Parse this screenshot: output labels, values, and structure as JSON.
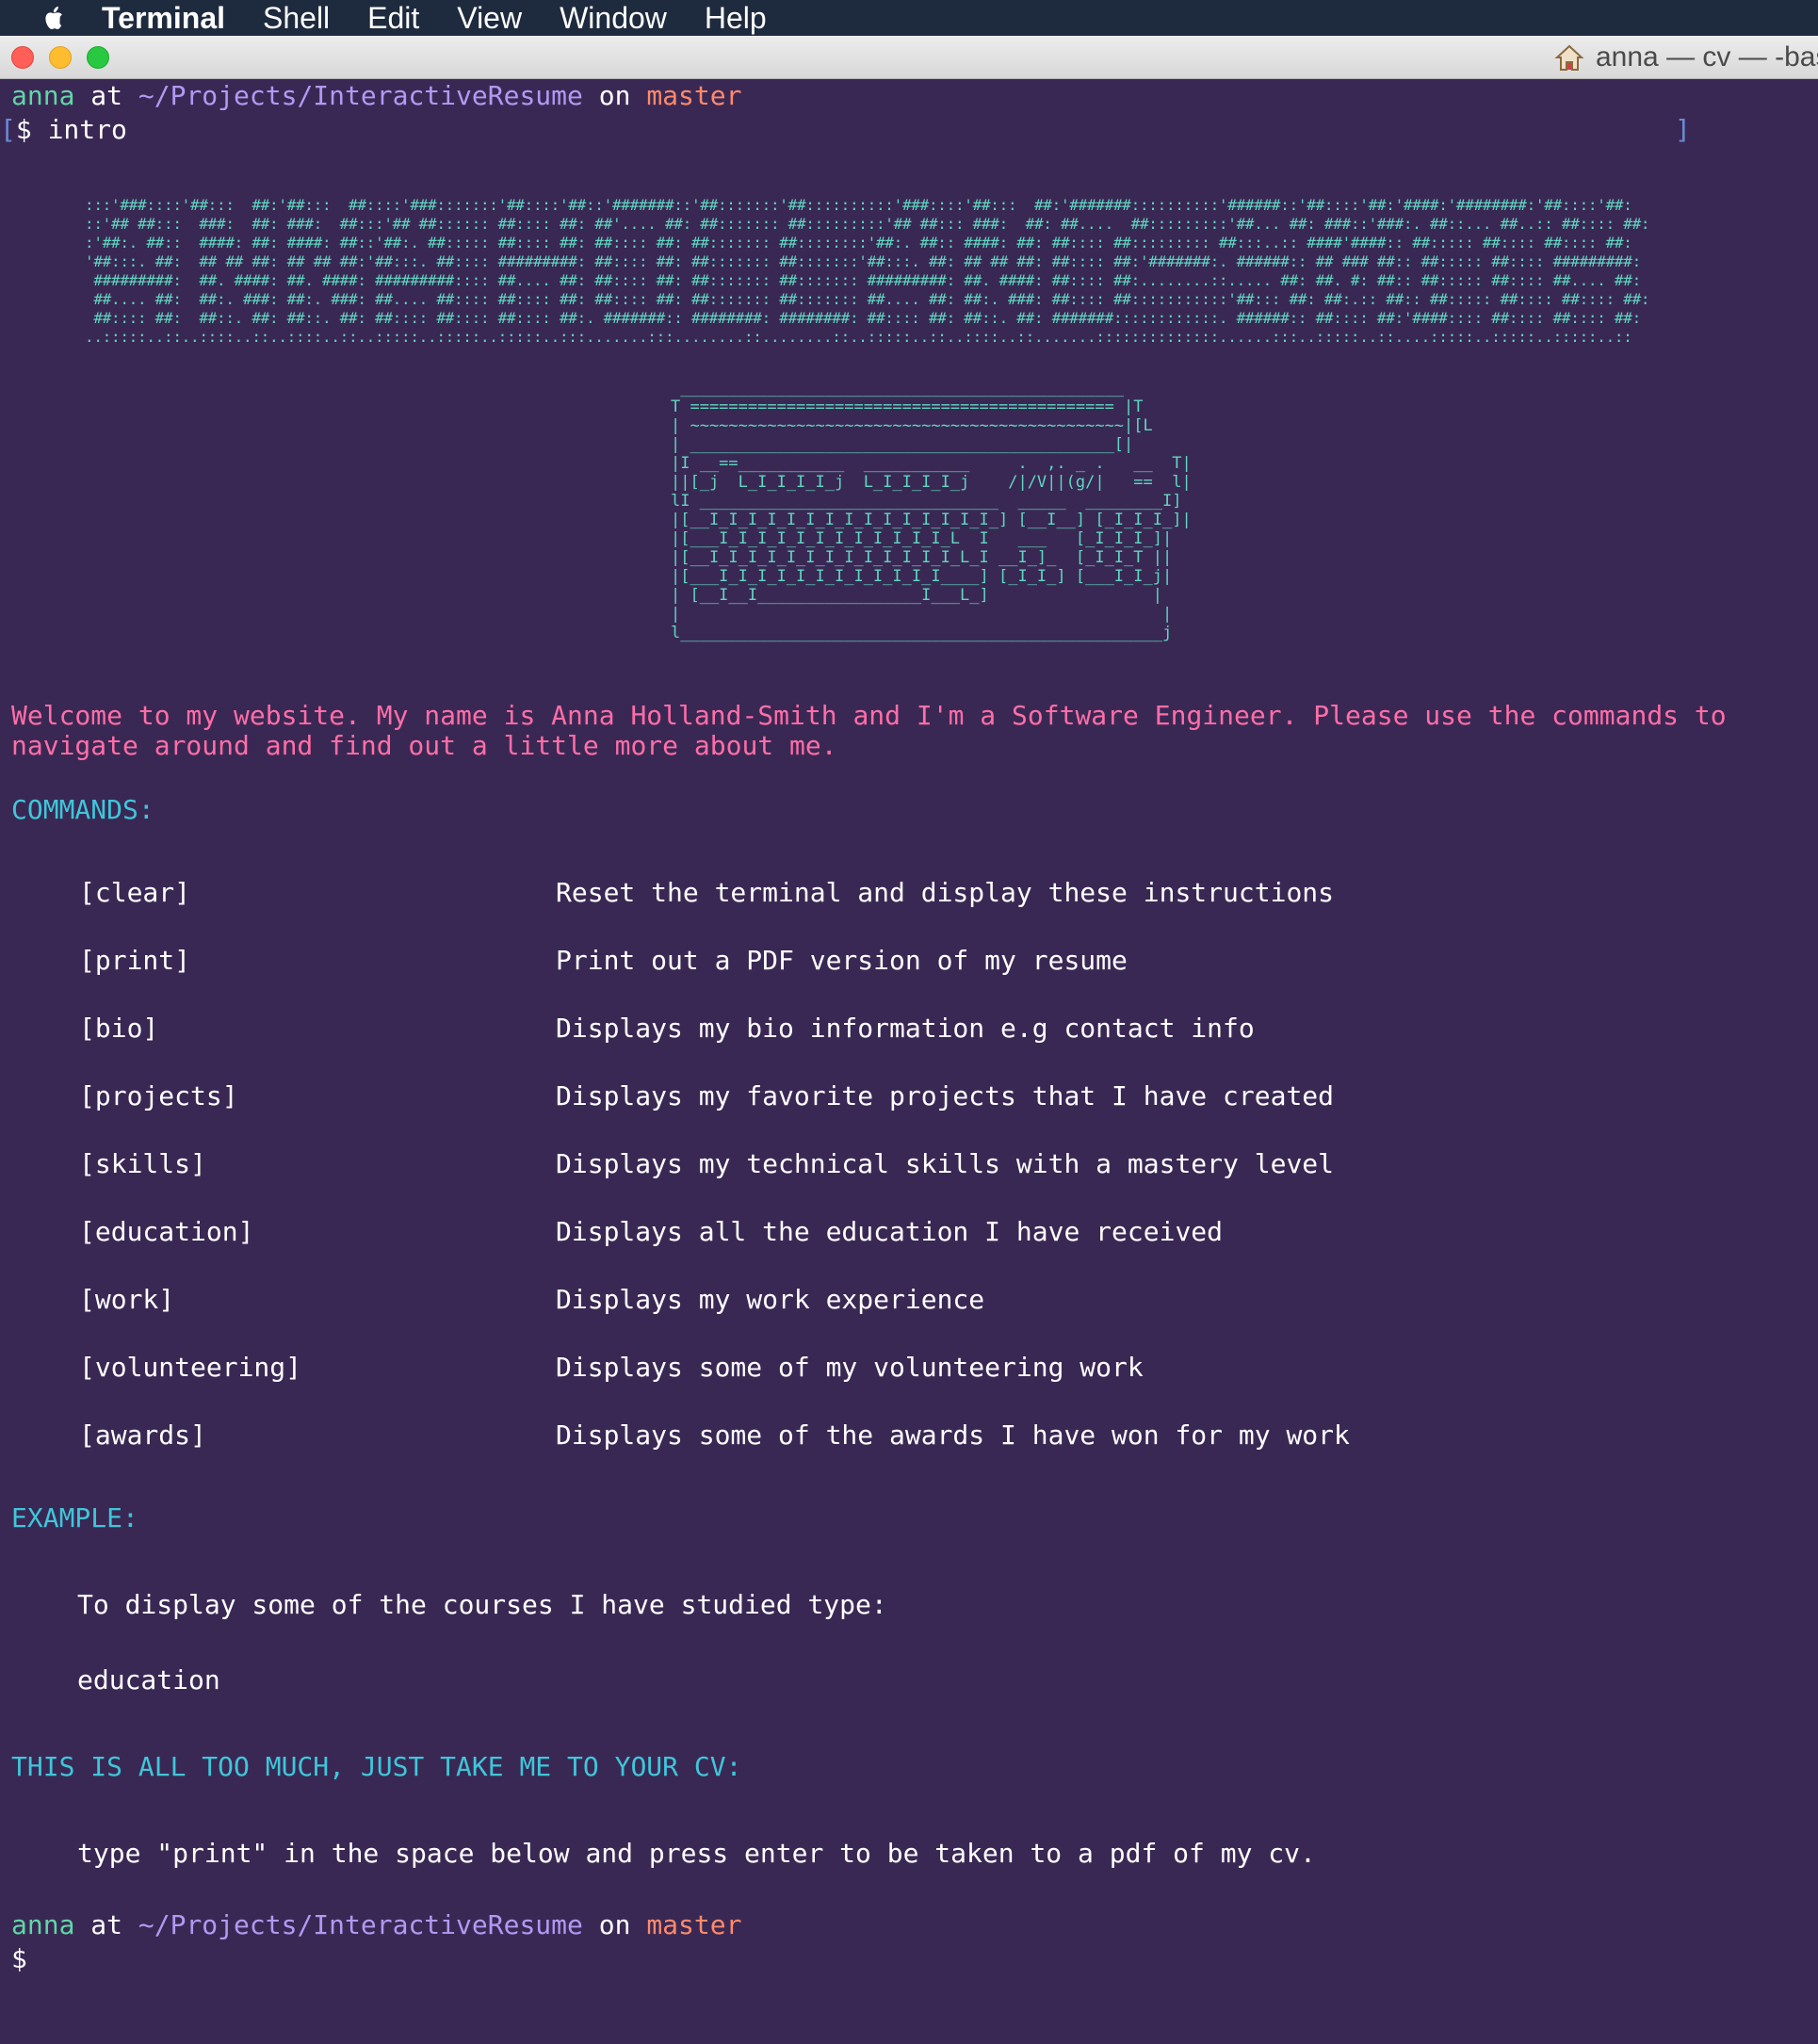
{
  "menubar": {
    "app_name": "Terminal",
    "items": [
      "Shell",
      "Edit",
      "View",
      "Window",
      "Help"
    ]
  },
  "window": {
    "title": "anna — cv — -bas",
    "icons": {
      "close": "close-light",
      "minimize": "minimize-light",
      "zoom": "zoom-light",
      "home": "home-icon",
      "apple": "apple-logo"
    }
  },
  "colors": {
    "background": "#3a2854",
    "user": "#5fd7a6",
    "path": "#b299f2",
    "branch": "#ff8a6b",
    "welcome": "#ff6ea7",
    "heading": "#3fc6d9",
    "ascii": "#5fd7c0"
  },
  "prompt": {
    "user": "anna",
    "at": "at",
    "path": "~/Projects/InteractiveResume",
    "on": "on",
    "branch": "master",
    "open_bracket": "[",
    "symbol": "$",
    "command": "intro",
    "close_bracket": "]"
  },
  "banner_lines": [
    ":::'###::::'##:::  ##:'##:::  ##::::'###:::::::'##::::'##::'#######::'##:::::::'##::::::::::'###::::'##:::  ##:'#######::::::::::'######::'##::::'##:'####:'########:'##::::'##:",
    "::'## ##:::  ###:  ##: ###:  ##:::'## ##:::::: ##:::: ##: ##'.... ##: ##::::::: ##:::::::::'## ##::: ###:  ##: ##....  ##:::::::::'##... ##: ###::'###:. ##::... ##..:: ##:::: ##:",
    ":'##:. ##::  ####: ##: ####: ##::'##:. ##::::: ##:::: ##: ##:::: ##: ##::::::: ##::::::::'##:. ##:: ####: ##: ##:::: ##::::::::: ##:::..:: ####'####:: ##::::: ##:::: ##:::: ##:",
    "'##:::. ##:  ## ## ##: ## ## ##:'##:::. ##:::: #########: ##:::: ##: ##::::::: ##:::::::'##:::. ##: ## ## ##: ##:::: ##:'#######:. ######:: ## ### ##:: ##::::: ##:::: #########:",
    " #########:  ##. ####: ##. ####: #########:::: ##.... ##: ##:::: ##: ##::::::: ##::::::: #########: ##. ####: ##:::: ##:........::..... ##: ##. #: ##:: ##::::: ##:::: ##.... ##:",
    " ##.... ##:  ##:. ###: ##:. ###: ##.... ##:::: ##:::: ##: ##:::: ##: ##::::::: ##::::::: ##.... ##: ##:. ###: ##:::: ##:::::::::::'##::: ##: ##:.:: ##:: ##::::: ##:::: ##:::: ##:",
    " ##:::: ##:  ##::. ##: ##::. ##: ##:::: ##:::: ##:::: ##:. #######:: ########: ########: ##:::: ##: ##::. ##: #######::::::::::::. ######:: ##:::: ##:'####:::: ##:::: ##:::: ##:",
    "..:::::..::..::::..::..::::..::..:::::..:::::..:::::..:::.......:::........::........::..:::::..::..::::..::.......::::::::::::::......:::..:::::..::....:::::..:::::..:::::..::"
  ],
  "art_lines": [
    " ______________________________________________",
    "T ============================================ |T",
    "| ~~~~~~~~~~~~~~~~~~~~~~~~~~~~~~~~~~~~~~~~~~~~~|[L",
    "| ____________________________________________[|",
    "|I __==___________  ___________     .  ,. _ .   __  T|",
    "||[_j  L_I_I_I_I_j  L_I_I_I_I_j    /|/V||(g/|   ==  l|",
    "lI _______________________________  _____  ________I]",
    "|[__I_I_I_I_I_I_I_I_I_I_I_I_I_I_I_] [__I__] [_I_I_I_]|",
    "|[___I_I_I_I_I_I_I_I_I_I_I_I_L  I   ___   [_I_I_I_]|",
    "|[__I_I_I_I_I_I_I_I_I_I_I_I_I_L_I __I_]_  [_I_I_T ||",
    "|[___I_I_I_I_I_I_I_I_I_I_I_I____] [_I_I_] [___I_I_j|",
    "| [__I__I_________________I___L_]                 |",
    "|                                                  |",
    "l__________________________________________________j"
  ],
  "welcome": {
    "line1": "Welcome to my website. My name is Anna Holland-Smith and I'm a Software Engineer. Please use the commands to",
    "line2": "navigate around and find out a little more about me."
  },
  "commands_heading": "COMMANDS:",
  "commands": [
    {
      "name": "[clear]",
      "desc": "Reset the terminal and display these instructions"
    },
    {
      "name": "[print]",
      "desc": "Print out a PDF version of my resume"
    },
    {
      "name": "[bio]",
      "desc": "Displays my bio information e.g contact info"
    },
    {
      "name": "[projects]",
      "desc": "Displays my favorite projects that I have created"
    },
    {
      "name": "[skills]",
      "desc": "Displays my technical skills with a mastery level"
    },
    {
      "name": "[education]",
      "desc": "Displays all the education I have received"
    },
    {
      "name": "[work]",
      "desc": "Displays my work experience"
    },
    {
      "name": "[volunteering]",
      "desc": "Displays some of my volunteering work"
    },
    {
      "name": "[awards]",
      "desc": "Displays some of the awards I have won for my work"
    }
  ],
  "example": {
    "heading": "EXAMPLE:",
    "text": "To display some of the courses I have studied type:",
    "command": "education"
  },
  "shortcut": {
    "heading": "THIS IS ALL TOO MUCH, JUST TAKE ME TO YOUR CV:",
    "text": "type \"print\" in the space below and press enter to be taken to a pdf of my cv."
  },
  "prompt2": {
    "user": "anna",
    "at": "at",
    "path": "~/Projects/InteractiveResume",
    "on": "on",
    "branch": "master",
    "symbol": "$"
  }
}
